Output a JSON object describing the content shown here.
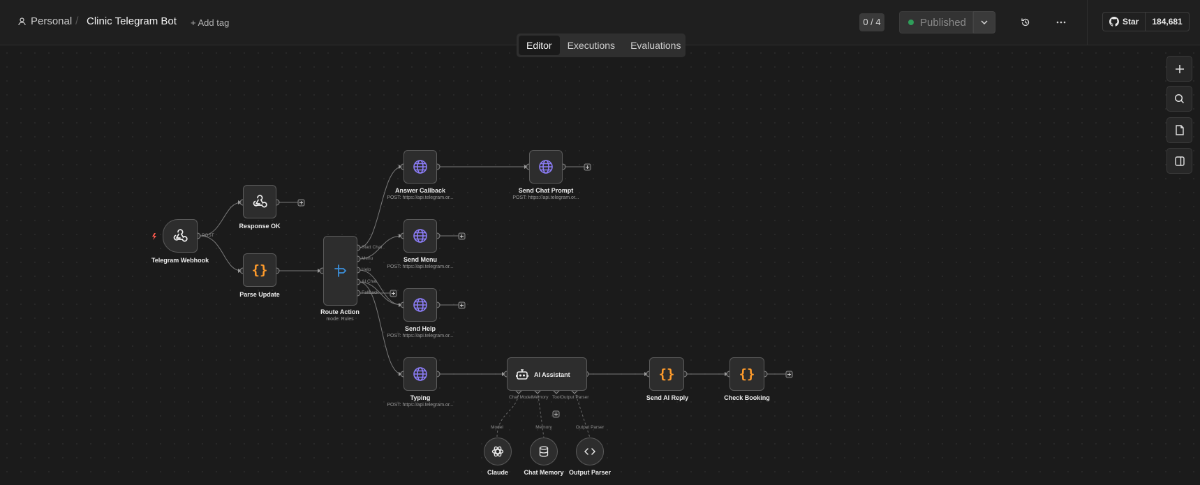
{
  "header": {
    "breadcrumb_personal": "Personal",
    "breadcrumb_sep": "/",
    "workflow_title": "Clinic Telegram Bot",
    "add_tag": "+ Add tag",
    "counter": "0 / 4",
    "published_label": "Published",
    "github_star": "Star",
    "github_count": "184,681"
  },
  "tabs": [
    "Editor",
    "Executions",
    "Evaluations"
  ],
  "active_tab": "Editor",
  "nodes": {
    "telegram_webhook": "Telegram Webhook",
    "response_ok": "Response OK",
    "parse_update": "Parse Update",
    "route_action": "Route Action",
    "route_action_sub": "mode: Rules",
    "answer_callback": "Answer Callback",
    "answer_callback_sub": "POST: https://api.telegram.or...",
    "send_chat_prompt": "Send Chat Prompt",
    "send_chat_prompt_sub": "POST: https://api.telegram.or...",
    "send_menu": "Send Menu",
    "send_menu_sub": "POST: https://api.telegram.or...",
    "send_help": "Send Help",
    "send_help_sub": "POST: https://api.telegram.or...",
    "typing": "Typing",
    "typing_sub": "POST: https://api.telegram.or...",
    "ai_assistant": "AI Assistant",
    "send_ai_reply": "Send AI Reply",
    "check_booking": "Check Booking",
    "claude": "Claude",
    "chat_memory": "Chat Memory",
    "output_parser": "Output Parser"
  },
  "ports": {
    "webhook_out": "POST",
    "route_outputs": [
      "Start Chat",
      "Menu",
      "Help",
      "AI Chat",
      "Fallback"
    ],
    "ai_inputs": [
      "Chat Model",
      "Memory",
      "Tool",
      "Output Parser"
    ],
    "sub_labels": [
      "Model",
      "Memory",
      "Output Parser"
    ]
  },
  "colors": {
    "accent_purple": "#8b7cf6",
    "code_orange": "#ff9b2b",
    "router_blue": "#3b8fd9",
    "published_green": "#2f9e5a",
    "trigger_red": "#ff5a4e"
  }
}
